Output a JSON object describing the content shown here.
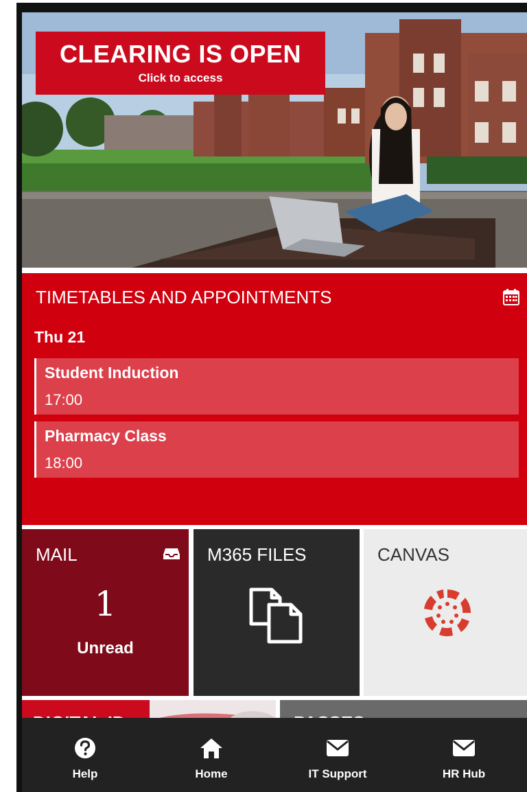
{
  "hero": {
    "promo_title": "CLEARING IS OPEN",
    "promo_subtitle": "Click to access"
  },
  "timetable": {
    "title": "TIMETABLES AND APPOINTMENTS",
    "icon": "calendar-icon",
    "day": "Thu 21",
    "events": [
      {
        "name": "Student Induction",
        "time": "17:00"
      },
      {
        "name": "Pharmacy Class",
        "time": "18:00"
      }
    ]
  },
  "tiles": {
    "mail": {
      "label": "MAIL",
      "icon": "inbox-icon",
      "count": "1",
      "status": "Unread"
    },
    "files": {
      "label": "M365 FILES",
      "icon": "files-icon"
    },
    "canvas": {
      "label": "CANVAS",
      "icon": "canvas-logo-icon"
    },
    "digital_id": {
      "label": "DIGITAL ID"
    },
    "passes": {
      "label": "PASSES"
    }
  },
  "bottom_nav": [
    {
      "label": "Help",
      "icon": "help-icon"
    },
    {
      "label": "Home",
      "icon": "home-icon"
    },
    {
      "label": "IT Support",
      "icon": "mail-icon"
    },
    {
      "label": "HR Hub",
      "icon": "mail-icon"
    }
  ],
  "colors": {
    "brand_red": "#d0000f",
    "promo_red": "#cc0a1e",
    "mail_tile": "#7f0a19",
    "files_tile": "#2a2a2a",
    "canvas_tile": "#ececec",
    "nav_bg": "#222222"
  }
}
